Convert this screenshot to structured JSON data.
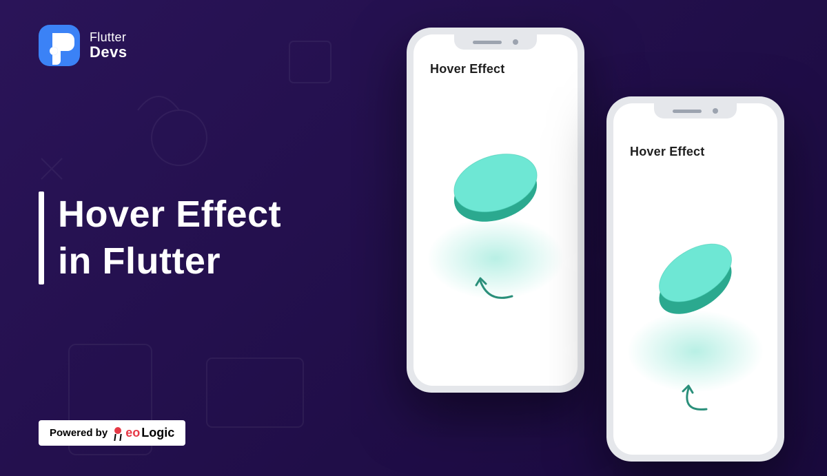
{
  "logo": {
    "line1": "Flutter",
    "line2": "Devs"
  },
  "title": {
    "line1": "Hover Effect",
    "line2": "in Flutter"
  },
  "powered": {
    "prefix": "Powered by",
    "brand_red": "eo",
    "brand_black": "Logic"
  },
  "phones": {
    "left_title": "Hover Effect",
    "right_title": "Hover Effect"
  },
  "colors": {
    "disc_top": "#5fe0c9",
    "disc_side": "#2ba98f",
    "arrow": "#2a8f7a"
  }
}
